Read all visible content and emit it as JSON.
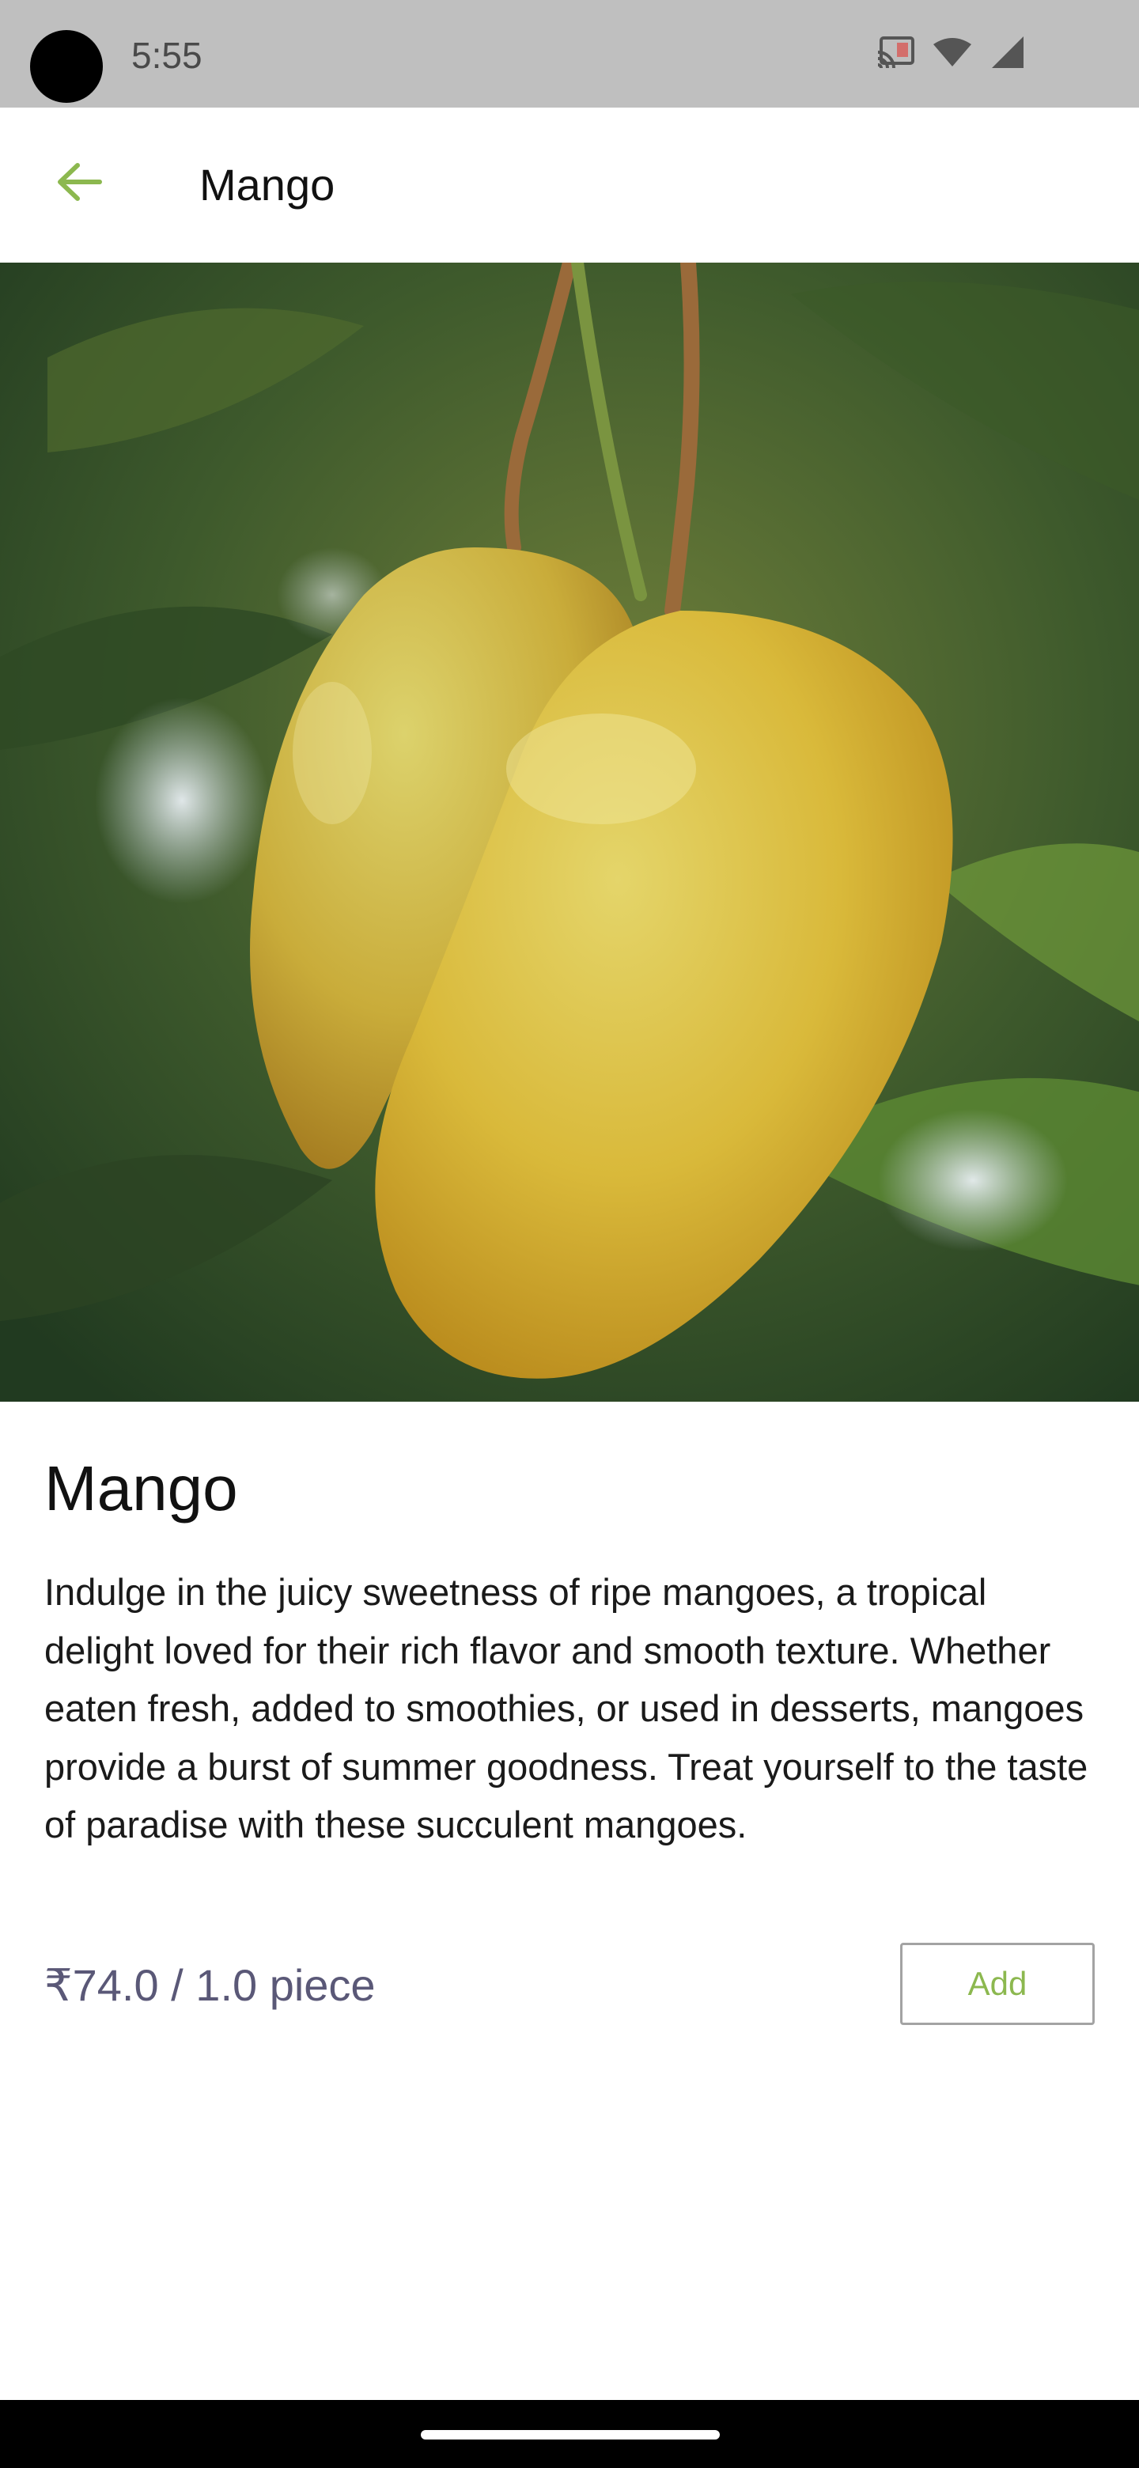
{
  "status_bar": {
    "time": "5:55",
    "icons": [
      "cast-icon",
      "wifi-icon",
      "cellular-signal-icon"
    ]
  },
  "app_bar": {
    "back_icon": "arrow-left-icon",
    "title": "Mango"
  },
  "product": {
    "image_alt": "Two ripe yellow mangoes hanging from a tree",
    "name": "Mango",
    "description": "Indulge in the juicy sweetness of ripe mangoes, a tropical delight loved for their rich flavor and smooth texture. Whether eaten fresh, added to smoothies, or used in desserts, mangoes provide a burst of summer goodness. Treat yourself to the taste of paradise with these succulent mangoes.",
    "price": "₹74.0 / 1.0 piece",
    "add_label": "Add"
  },
  "colors": {
    "accent": "#8cb84f",
    "price_text": "#5a5877",
    "status_bar_bg": "#bfbfbf"
  }
}
